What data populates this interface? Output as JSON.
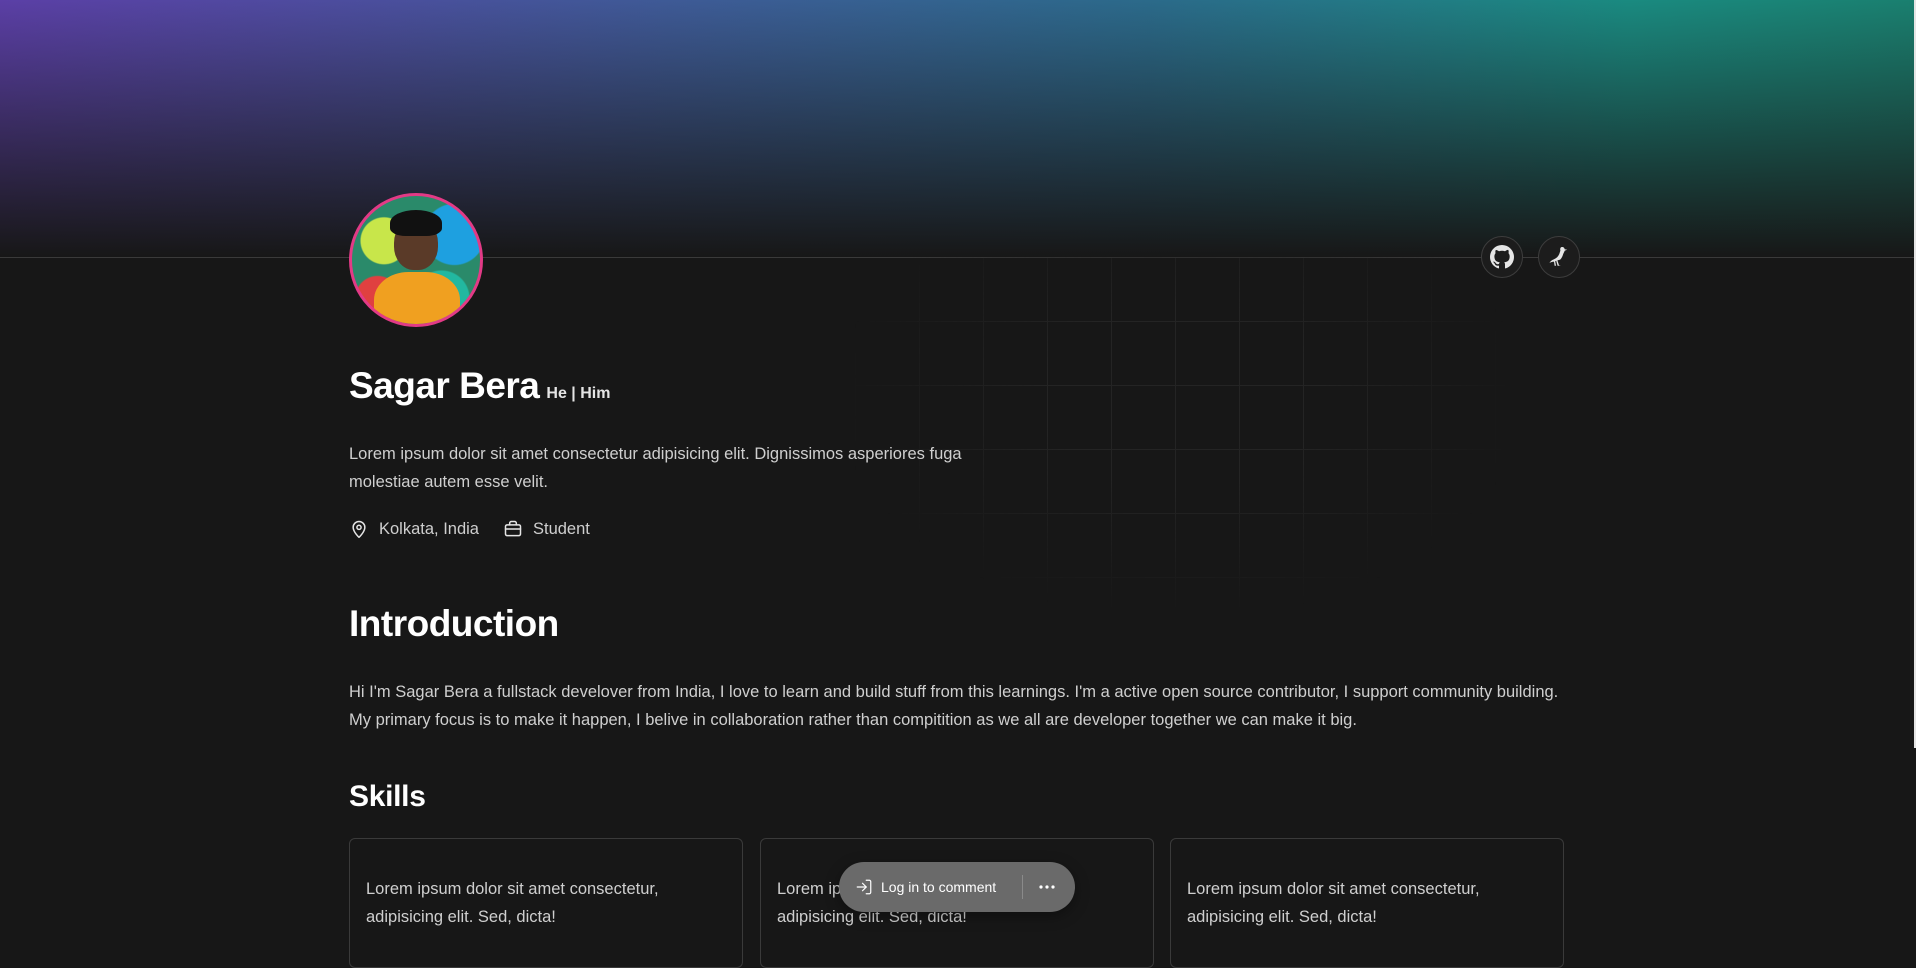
{
  "profile": {
    "name": "Sagar Bera",
    "pronouns": "He | Him",
    "bio": "Lorem ipsum dolor sit amet consectetur adipisicing elit. Dignissimos asperiores fuga molestiae autem esse velit.",
    "location": "Kolkata, India",
    "occupation": "Student"
  },
  "social": {
    "github_icon": "github-icon",
    "hashnode_icon": "bird-icon"
  },
  "introduction": {
    "heading": "Introduction",
    "text": "Hi I'm Sagar Bera a fullstack develover from India, I love to learn and build stuff from this learnings. I'm a active open source contributor, I support community building. My primary focus is to make it happen, I belive in collaboration rather than compitition as we all are developer together we can make it big."
  },
  "skills": {
    "heading": "Skills",
    "cards": [
      {
        "text": "Lorem ipsum dolor sit amet consectetur, adipisicing elit. Sed, dicta!"
      },
      {
        "text": "Lorem ipsum dolor sit amet consectetur, adipisicing elit. Sed, dicta!"
      },
      {
        "text": "Lorem ipsum dolor sit amet consectetur, adipisicing elit. Sed, dicta!"
      }
    ]
  },
  "comment_bar": {
    "login_label": "Log in to comment",
    "more_icon": "more-icon"
  },
  "colors": {
    "background": "#171717",
    "avatar_ring": "#e23a86",
    "banner_left": "#5b3fa6",
    "banner_right": "#1a7f6f"
  }
}
